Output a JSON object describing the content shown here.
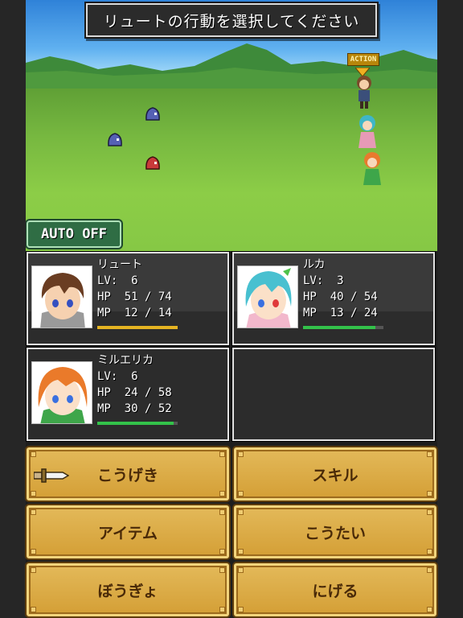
{
  "battle": {
    "title": "リュートの行動を選択してください",
    "action_tag": "ACTION",
    "auto_button": "AUTO OFF",
    "colors": {
      "sky": "#5fb0f0",
      "grass": "#86c845",
      "slime_blue": "#5560b4",
      "slime_red": "#c83a3a"
    }
  },
  "party": [
    {
      "name": "リュート",
      "lv_label": "LV:",
      "lv": "6",
      "hp_label": "HP",
      "hp": "51",
      "hp_max": "74",
      "mp_label": "MP",
      "mp": "12",
      "mp_max": "14",
      "bar_ratio": 1.0,
      "bar_color": "#e6b422"
    },
    {
      "name": "ルカ",
      "lv_label": "LV:",
      "lv": "3",
      "hp_label": "HP",
      "hp": "40",
      "hp_max": "54",
      "mp_label": "MP",
      "mp": "13",
      "mp_max": "24",
      "bar_ratio": 0.9,
      "bar_color": "#33c24a"
    },
    {
      "name": "ミルエリカ",
      "lv_label": "LV:",
      "lv": "6",
      "hp_label": "HP",
      "hp": "24",
      "hp_max": "58",
      "mp_label": "MP",
      "mp": "30",
      "mp_max": "52",
      "bar_ratio": 0.95,
      "bar_color": "#33c24a"
    }
  ],
  "commands": {
    "attack": "こうげき",
    "skill": "スキル",
    "item": "アイテム",
    "retreat": "こうたい",
    "defend": "ぼうぎょ",
    "escape": "にげる"
  }
}
